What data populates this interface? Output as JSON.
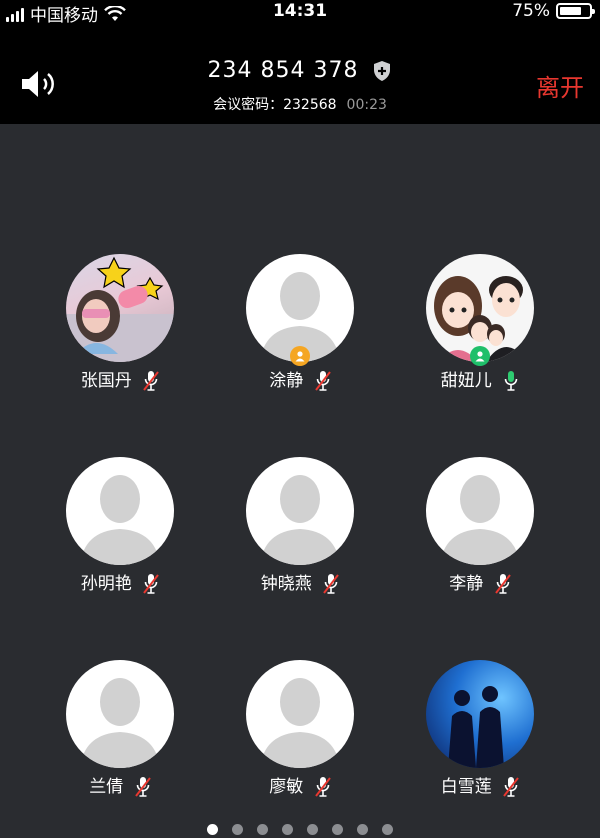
{
  "status_bar": {
    "carrier": "中国移动",
    "time": "14:31",
    "battery": "75%",
    "battery_level": 0.75
  },
  "header": {
    "meeting_id": "234 854 378",
    "password_label": "会议密码：",
    "password": "232568",
    "duration": "00:23",
    "leave_label": "离开"
  },
  "participants": [
    {
      "name": "张国丹",
      "avatar": "photo-avatar",
      "mic": "muted"
    },
    {
      "name": "涂静",
      "avatar": "default-avatar",
      "mic": "muted",
      "badge": "host-badge"
    },
    {
      "name": "甜妞儿",
      "avatar": "cartoon-avatar",
      "mic": "active",
      "badge": "cohost-badge"
    },
    {
      "name": "孙明艳",
      "avatar": "default-avatar",
      "mic": "muted"
    },
    {
      "name": "钟晓燕",
      "avatar": "default-avatar",
      "mic": "muted"
    },
    {
      "name": "李静",
      "avatar": "default-avatar",
      "mic": "muted"
    },
    {
      "name": "兰倩",
      "avatar": "default-avatar",
      "mic": "muted"
    },
    {
      "name": "廖敏",
      "avatar": "default-avatar",
      "mic": "muted"
    },
    {
      "name": "白雪莲",
      "avatar": "blue-photo-avatar",
      "mic": "muted"
    }
  ],
  "pager": {
    "count": 8,
    "active": 1
  },
  "colors": {
    "background": "#2a2c30",
    "leave": "#e8372f",
    "mic_active": "#2ecc71",
    "mic_muted_slash": "#e8372f",
    "host_badge": "#f5a623",
    "cohost_badge": "#1fbf6a"
  }
}
